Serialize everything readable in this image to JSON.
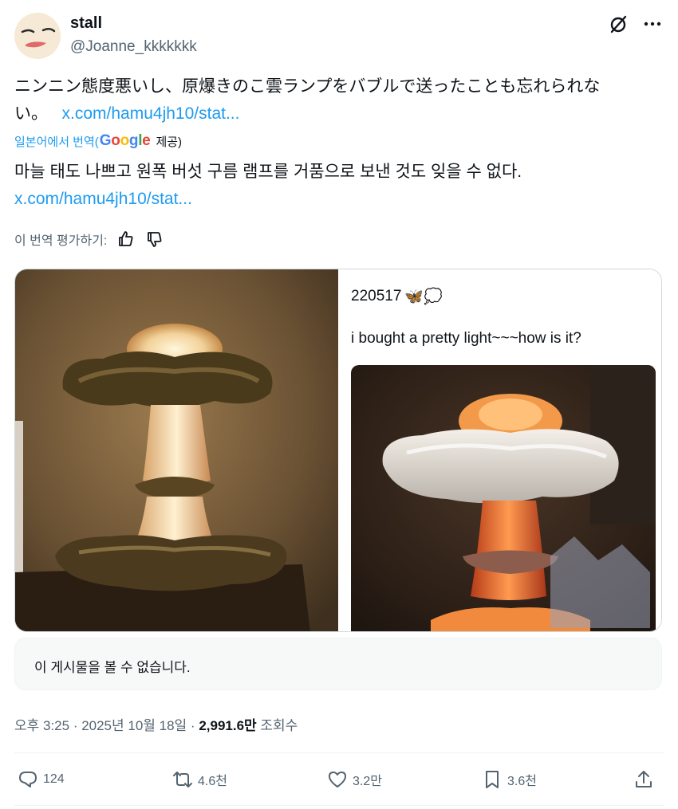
{
  "user": {
    "name": "stall",
    "handle": "@Joanne_kkkkkkk"
  },
  "tweet": {
    "original_text": "ニンニン態度悪いし、原爆きのこ雲ランプをバブルで送ったことも忘れられない。",
    "original_link": "x.com/hamu4jh10/stat...",
    "translate_label": "일본어에서 번역(",
    "google_label": "Google",
    "provided_label": "제공)",
    "translated_text": "마늘 태도 나쁘고 원폭 버섯 구름 램프를 거품으로 보낸 것도 잊을 수 없다.",
    "translated_link": "x.com/hamu4jh10/stat...",
    "rate_label": "이 번역 평가하기:"
  },
  "quoted": {
    "date": "220517",
    "emojis": "🦋💭",
    "caption": "i bought a pretty light~~~how is it?"
  },
  "unavailable": "이 게시물을 볼 수 없습니다.",
  "meta": {
    "time": "오후 3:25 · 2025년 10월 18일 · ",
    "views": "2,991.6만",
    "views_label": " 조회수"
  },
  "actions": {
    "replies": "124",
    "reposts": "4.6천",
    "likes": "3.2만",
    "bookmarks": "3.6천"
  },
  "colors": {
    "accent": "#1d9bf0",
    "secondary_text": "#536471",
    "text": "#0f1419"
  },
  "icons": [
    "grok-icon",
    "more-icon",
    "thumbs-up-icon",
    "thumbs-down-icon",
    "reply-icon",
    "repost-icon",
    "like-icon",
    "bookmark-icon",
    "share-icon"
  ]
}
